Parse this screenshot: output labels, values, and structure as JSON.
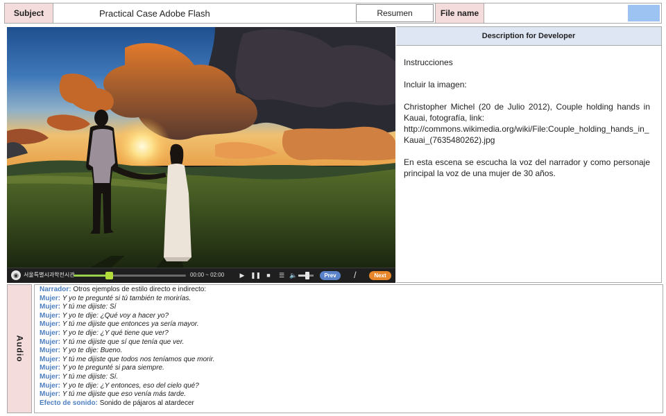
{
  "header": {
    "subject_label": "Subject",
    "subject_value": "Practical Case Adobe Flash",
    "resumen_button": "Resumen",
    "filename_label": "File name",
    "filename_value": "",
    "accent_color": "#9dc3f3"
  },
  "player": {
    "museum_label": "서울특별시과학전시관",
    "time": "00:00 ~ 02:00",
    "progress": 0.32,
    "volume": 0.6,
    "prev_label": "Prev",
    "separator": "/",
    "next_label": "Next",
    "icons": [
      "museum-logo-icon",
      "play-icon",
      "pause-icon",
      "stop-icon",
      "list-icon",
      "volume-icon"
    ],
    "prev_color": "#5a82c8",
    "next_color": "#e8862a"
  },
  "description": {
    "title": "Description for Developer",
    "p1": "Instrucciones",
    "p2": "Incluir la imagen:",
    "p3": "Christopher Michel (20 de Julio 2012), Couple holding hands in Kauai, fotografía, link:",
    "p3_link": "http://commons.wikimedia.org/wiki/File:Couple_holding_hands_in_Kauai_(7635480262).jpg",
    "p4": "En esta escena se escucha la voz del narrador y como personaje principal la voz de una mujer de 30 años."
  },
  "audio": {
    "tab_label": "Audio",
    "lines": [
      {
        "speaker": "Narrador:",
        "text": "Otros ejemplos de estilo directo e indirecto:",
        "italic": false
      },
      {
        "speaker": "Mujer:",
        "text": "Y yo te pregunté si tú también te morirías.",
        "italic": true
      },
      {
        "speaker": "Mujer:",
        "text": "Y tú me dijiste: Sí",
        "italic": true
      },
      {
        "speaker": "Mujer:",
        "text": "Y yo te dije: ¿Qué voy a hacer yo?",
        "italic": true
      },
      {
        "speaker": "Mujer:",
        "text": "Y tú me dijiste que entonces ya sería mayor.",
        "italic": true
      },
      {
        "speaker": "Mujer:",
        "text": "Y yo te dije: ¿Y qué tiene que ver?",
        "italic": true
      },
      {
        "speaker": "Mujer:",
        "text": "Y tú me dijiste que sí que tenía que ver.",
        "italic": true
      },
      {
        "speaker": "Mujer:",
        "text": "Y yo te dije: Bueno.",
        "italic": true
      },
      {
        "speaker": "Mujer:",
        "text": "Y tú me dijiste que todos nos teníamos que morir.",
        "italic": true
      },
      {
        "speaker": "Mujer:",
        "text": "Y yo te pregunté si para siempre.",
        "italic": true
      },
      {
        "speaker": "Mujer:",
        "text": "Y tú me dijiste: Sí.",
        "italic": true
      },
      {
        "speaker": "Mujer:",
        "text": "Y yo te dije: ¿Y entonces, eso del cielo qué?",
        "italic": true
      },
      {
        "speaker": "Mujer:",
        "text": "Y tú me dijiste que eso venía más tarde.",
        "italic": true
      },
      {
        "speaker": "Efecto de sonido:",
        "text": "Sonido de pájaros al atardecer",
        "italic": false
      }
    ]
  }
}
